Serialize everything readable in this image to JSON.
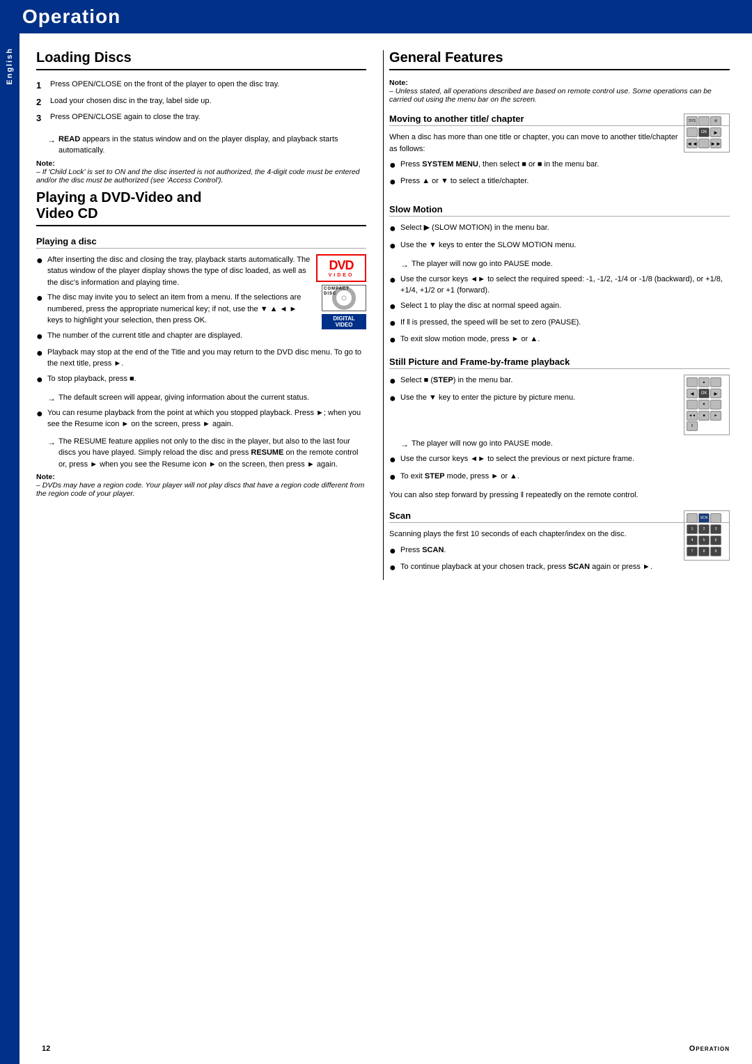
{
  "page": {
    "title": "Operation",
    "footer_page": "12",
    "footer_section": "Operation",
    "sidebar_label": "English"
  },
  "left_column": {
    "loading_discs": {
      "heading": "Loading Discs",
      "steps": [
        {
          "num": "1",
          "text": "Press OPEN/CLOSE on the front of the player to open the disc tray."
        },
        {
          "num": "2",
          "text": "Load your chosen disc in the tray, label side up."
        },
        {
          "num": "3",
          "text": "Press OPEN/CLOSE again to close the tray."
        }
      ],
      "arrow_text": "→ READ appears in the status window and on the player display, and playback starts automatically.",
      "note_label": "Note:",
      "note_text": "– If 'Child Lock' is set to ON and the disc inserted is not authorized, the 4-digit code must be entered and/or the disc must be authorized (see 'Access Control')."
    },
    "playing_dvd": {
      "heading": "Playing a DVD-Video and Video CD",
      "subheading": "Playing a disc",
      "bullets": [
        "After inserting the disc and closing the tray, playback starts automatically. The status window of the player display shows the type of disc loaded, as well as the disc's information and playing time.",
        "The disc may invite you to select an item from a menu. If the selections are numbered, press the appropriate numerical key; if not, use the ▼ ▲ ◄ ► keys to highlight your selection, then press OK.",
        "The number of the current title and chapter are displayed.",
        "Playback may stop at the end of the Title and you may return to the DVD disc menu. To go to the next title, press ►.",
        "To stop playback, press ■."
      ],
      "arrow1": "→ The default screen will appear, giving information about the current status.",
      "bullet2": "You can resume playback from the point at which you stopped playback. Press ►; when you see the Resume icon ► on the screen, press ► again.",
      "arrow2": "→ The RESUME feature applies not only to the disc in the player, but also to the last four discs you have played. Simply reload the disc and press RESUME on the remote control or, press ► when you see the Resume icon ► on the screen, then press ► again.",
      "note_label": "Note:",
      "note_text": "– DVDs may have a region code. Your player will not play discs that have a region code different from the region code of your player."
    }
  },
  "right_column": {
    "general_features": {
      "heading": "General Features",
      "note_label": "Note:",
      "note_text": "– Unless stated, all operations described are based on remote control use. Some operations can be carried out using the menu bar on the screen."
    },
    "moving_title": {
      "subheading": "Moving to another title/ chapter",
      "intro": "When a disc has more than one title or chapter, you can move to another title/chapter as follows:",
      "bullets": [
        "Press SYSTEM MENU, then select ■ or ■ in the menu bar.",
        "Press ▲ or ▼ to select a title/chapter."
      ]
    },
    "slow_motion": {
      "subheading": "Slow Motion",
      "bullets": [
        "Select ▶ (SLOW MOTION) in the menu bar.",
        "Use the ▼ keys to enter the SLOW MOTION menu.",
        "Use the cursor keys ◄► to select the required speed: -1, -1/2, -1/4 or -1/8 (backward), or +1/8, +1/4, +1/2 or +1 (forward).",
        "Select 1 to play the disc at normal speed again.",
        "If ‖ is pressed, the speed will be set to zero (PAUSE).",
        "To exit slow motion mode, press ► or ▲."
      ],
      "arrow1": "→ The player will now go into PAUSE mode."
    },
    "still_picture": {
      "subheading": "Still Picture and Frame-by-frame playback",
      "bullets": [
        "Select ■ (STEP) in the menu bar.",
        "Use the ▼ key to enter the picture by picture menu.",
        "Use the cursor keys ◄► to select the previous or next picture frame.",
        "To exit STEP mode, press ► or ▲."
      ],
      "arrow1": "→ The player will now go into PAUSE mode.",
      "extra_text": "You can also step forward by pressing ‖ repeatedly on the remote control."
    },
    "scan": {
      "subheading": "Scan",
      "intro": "Scanning plays the first 10 seconds of each chapter/index on the disc.",
      "bullets": [
        "Press SCAN.",
        "To continue playback at your chosen track, press SCAN again or press ►."
      ]
    }
  }
}
